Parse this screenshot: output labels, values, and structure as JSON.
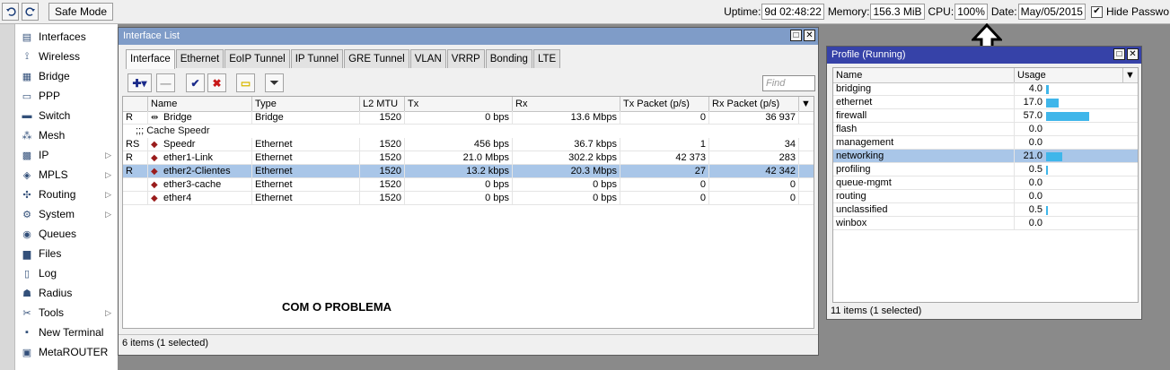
{
  "toolbar": {
    "undo_icon": "undo-icon",
    "redo_icon": "redo-icon",
    "safe_mode_label": "Safe Mode"
  },
  "status": {
    "uptime_label": "Uptime:",
    "uptime": "9d 02:48:22",
    "memory_label": "Memory:",
    "memory": "156.3 MiB",
    "cpu_label": "CPU:",
    "cpu": "100%",
    "date_label": "Date:",
    "date": "May/05/2015",
    "hide_label": "Hide Passwo",
    "hide_checked": "✔"
  },
  "sidebar": {
    "items": [
      {
        "label": "Interfaces",
        "icon": "interfaces-icon",
        "glyph": "▤",
        "sub": false
      },
      {
        "label": "Wireless",
        "icon": "wireless-icon",
        "glyph": "⟟",
        "sub": false
      },
      {
        "label": "Bridge",
        "icon": "bridge-icon",
        "glyph": "▦",
        "sub": false
      },
      {
        "label": "PPP",
        "icon": "ppp-icon",
        "glyph": "▭",
        "sub": false
      },
      {
        "label": "Switch",
        "icon": "switch-icon",
        "glyph": "▬",
        "sub": false
      },
      {
        "label": "Mesh",
        "icon": "mesh-icon",
        "glyph": "⁂",
        "sub": false
      },
      {
        "label": "IP",
        "icon": "ip-icon",
        "glyph": "▩",
        "sub": true
      },
      {
        "label": "MPLS",
        "icon": "mpls-icon",
        "glyph": "◈",
        "sub": true
      },
      {
        "label": "Routing",
        "icon": "routing-icon",
        "glyph": "✣",
        "sub": true
      },
      {
        "label": "System",
        "icon": "system-icon",
        "glyph": "⚙",
        "sub": true
      },
      {
        "label": "Queues",
        "icon": "queues-icon",
        "glyph": "◉",
        "sub": false
      },
      {
        "label": "Files",
        "icon": "files-icon",
        "glyph": "▆",
        "sub": false
      },
      {
        "label": "Log",
        "icon": "log-icon",
        "glyph": "▯",
        "sub": false
      },
      {
        "label": "Radius",
        "icon": "radius-icon",
        "glyph": "☗",
        "sub": false
      },
      {
        "label": "Tools",
        "icon": "tools-icon",
        "glyph": "✂",
        "sub": true
      },
      {
        "label": "New Terminal",
        "icon": "terminal-icon",
        "glyph": "▪",
        "sub": false
      },
      {
        "label": "MetaROUTER",
        "icon": "metarouter-icon",
        "glyph": "▣",
        "sub": false
      }
    ]
  },
  "interface_list": {
    "title": "Interface List",
    "tabs": [
      "Interface",
      "Ethernet",
      "EoIP Tunnel",
      "IP Tunnel",
      "GRE Tunnel",
      "VLAN",
      "VRRP",
      "Bonding",
      "LTE"
    ],
    "find_placeholder": "Find",
    "columns": [
      "Name",
      "Type",
      "L2 MTU",
      "Tx",
      "Rx",
      "Tx Packet (p/s)",
      "Rx Packet (p/s)"
    ],
    "rows": [
      {
        "flag": "R",
        "name": "Bridge",
        "type": "Bridge",
        "mtu": "1520",
        "tx": "0 bps",
        "rx": "13.6 Mbps",
        "txp": "0",
        "rxp": "36 937",
        "selected": false
      },
      {
        "comment": ";;; Cache Speedr"
      },
      {
        "flag": "RS",
        "name": "Speedr",
        "type": "Ethernet",
        "mtu": "1520",
        "tx": "456 bps",
        "rx": "36.7 kbps",
        "txp": "1",
        "rxp": "34",
        "selected": false
      },
      {
        "flag": "R",
        "name": "ether1-Link",
        "type": "Ethernet",
        "mtu": "1520",
        "tx": "21.0 Mbps",
        "rx": "302.2 kbps",
        "txp": "42 373",
        "rxp": "283",
        "selected": false
      },
      {
        "flag": "R",
        "name": "ether2-Clientes",
        "type": "Ethernet",
        "mtu": "1520",
        "tx": "13.2 kbps",
        "rx": "20.3 Mbps",
        "txp": "27",
        "rxp": "42 342",
        "selected": true
      },
      {
        "flag": "",
        "name": "ether3-cache",
        "type": "Ethernet",
        "mtu": "1520",
        "tx": "0 bps",
        "rx": "0 bps",
        "txp": "0",
        "rxp": "0",
        "selected": false
      },
      {
        "flag": "",
        "name": "ether4",
        "type": "Ethernet",
        "mtu": "1520",
        "tx": "0 bps",
        "rx": "0 bps",
        "txp": "0",
        "rxp": "0",
        "selected": false
      }
    ],
    "annotation": "COM O PROBLEMA",
    "footer": "6 items (1 selected)"
  },
  "profile": {
    "title": "Profile (Running)",
    "columns": [
      "Name",
      "Usage"
    ],
    "rows": [
      {
        "name": "bridging",
        "usage": "4.0",
        "pct": 4.0,
        "selected": false
      },
      {
        "name": "ethernet",
        "usage": "17.0",
        "pct": 17.0,
        "selected": false
      },
      {
        "name": "firewall",
        "usage": "57.0",
        "pct": 57.0,
        "selected": false
      },
      {
        "name": "flash",
        "usage": "0.0",
        "pct": 0,
        "selected": false
      },
      {
        "name": "management",
        "usage": "0.0",
        "pct": 0,
        "selected": false
      },
      {
        "name": "networking",
        "usage": "21.0",
        "pct": 21.0,
        "selected": true
      },
      {
        "name": "profiling",
        "usage": "0.5",
        "pct": 0.5,
        "selected": false
      },
      {
        "name": "queue-mgmt",
        "usage": "0.0",
        "pct": 0,
        "selected": false
      },
      {
        "name": "routing",
        "usage": "0.0",
        "pct": 0,
        "selected": false
      },
      {
        "name": "unclassified",
        "usage": "0.5",
        "pct": 0.5,
        "selected": false
      },
      {
        "name": "winbox",
        "usage": "0.0",
        "pct": 0,
        "selected": false
      }
    ],
    "footer": "11 items (1 selected)"
  },
  "colors": {
    "title_bar": "#7f9cc8",
    "profile_title_bar": "#3642a8",
    "usage_bar": "#3fb6ea",
    "selection": "#a9c6e8"
  }
}
